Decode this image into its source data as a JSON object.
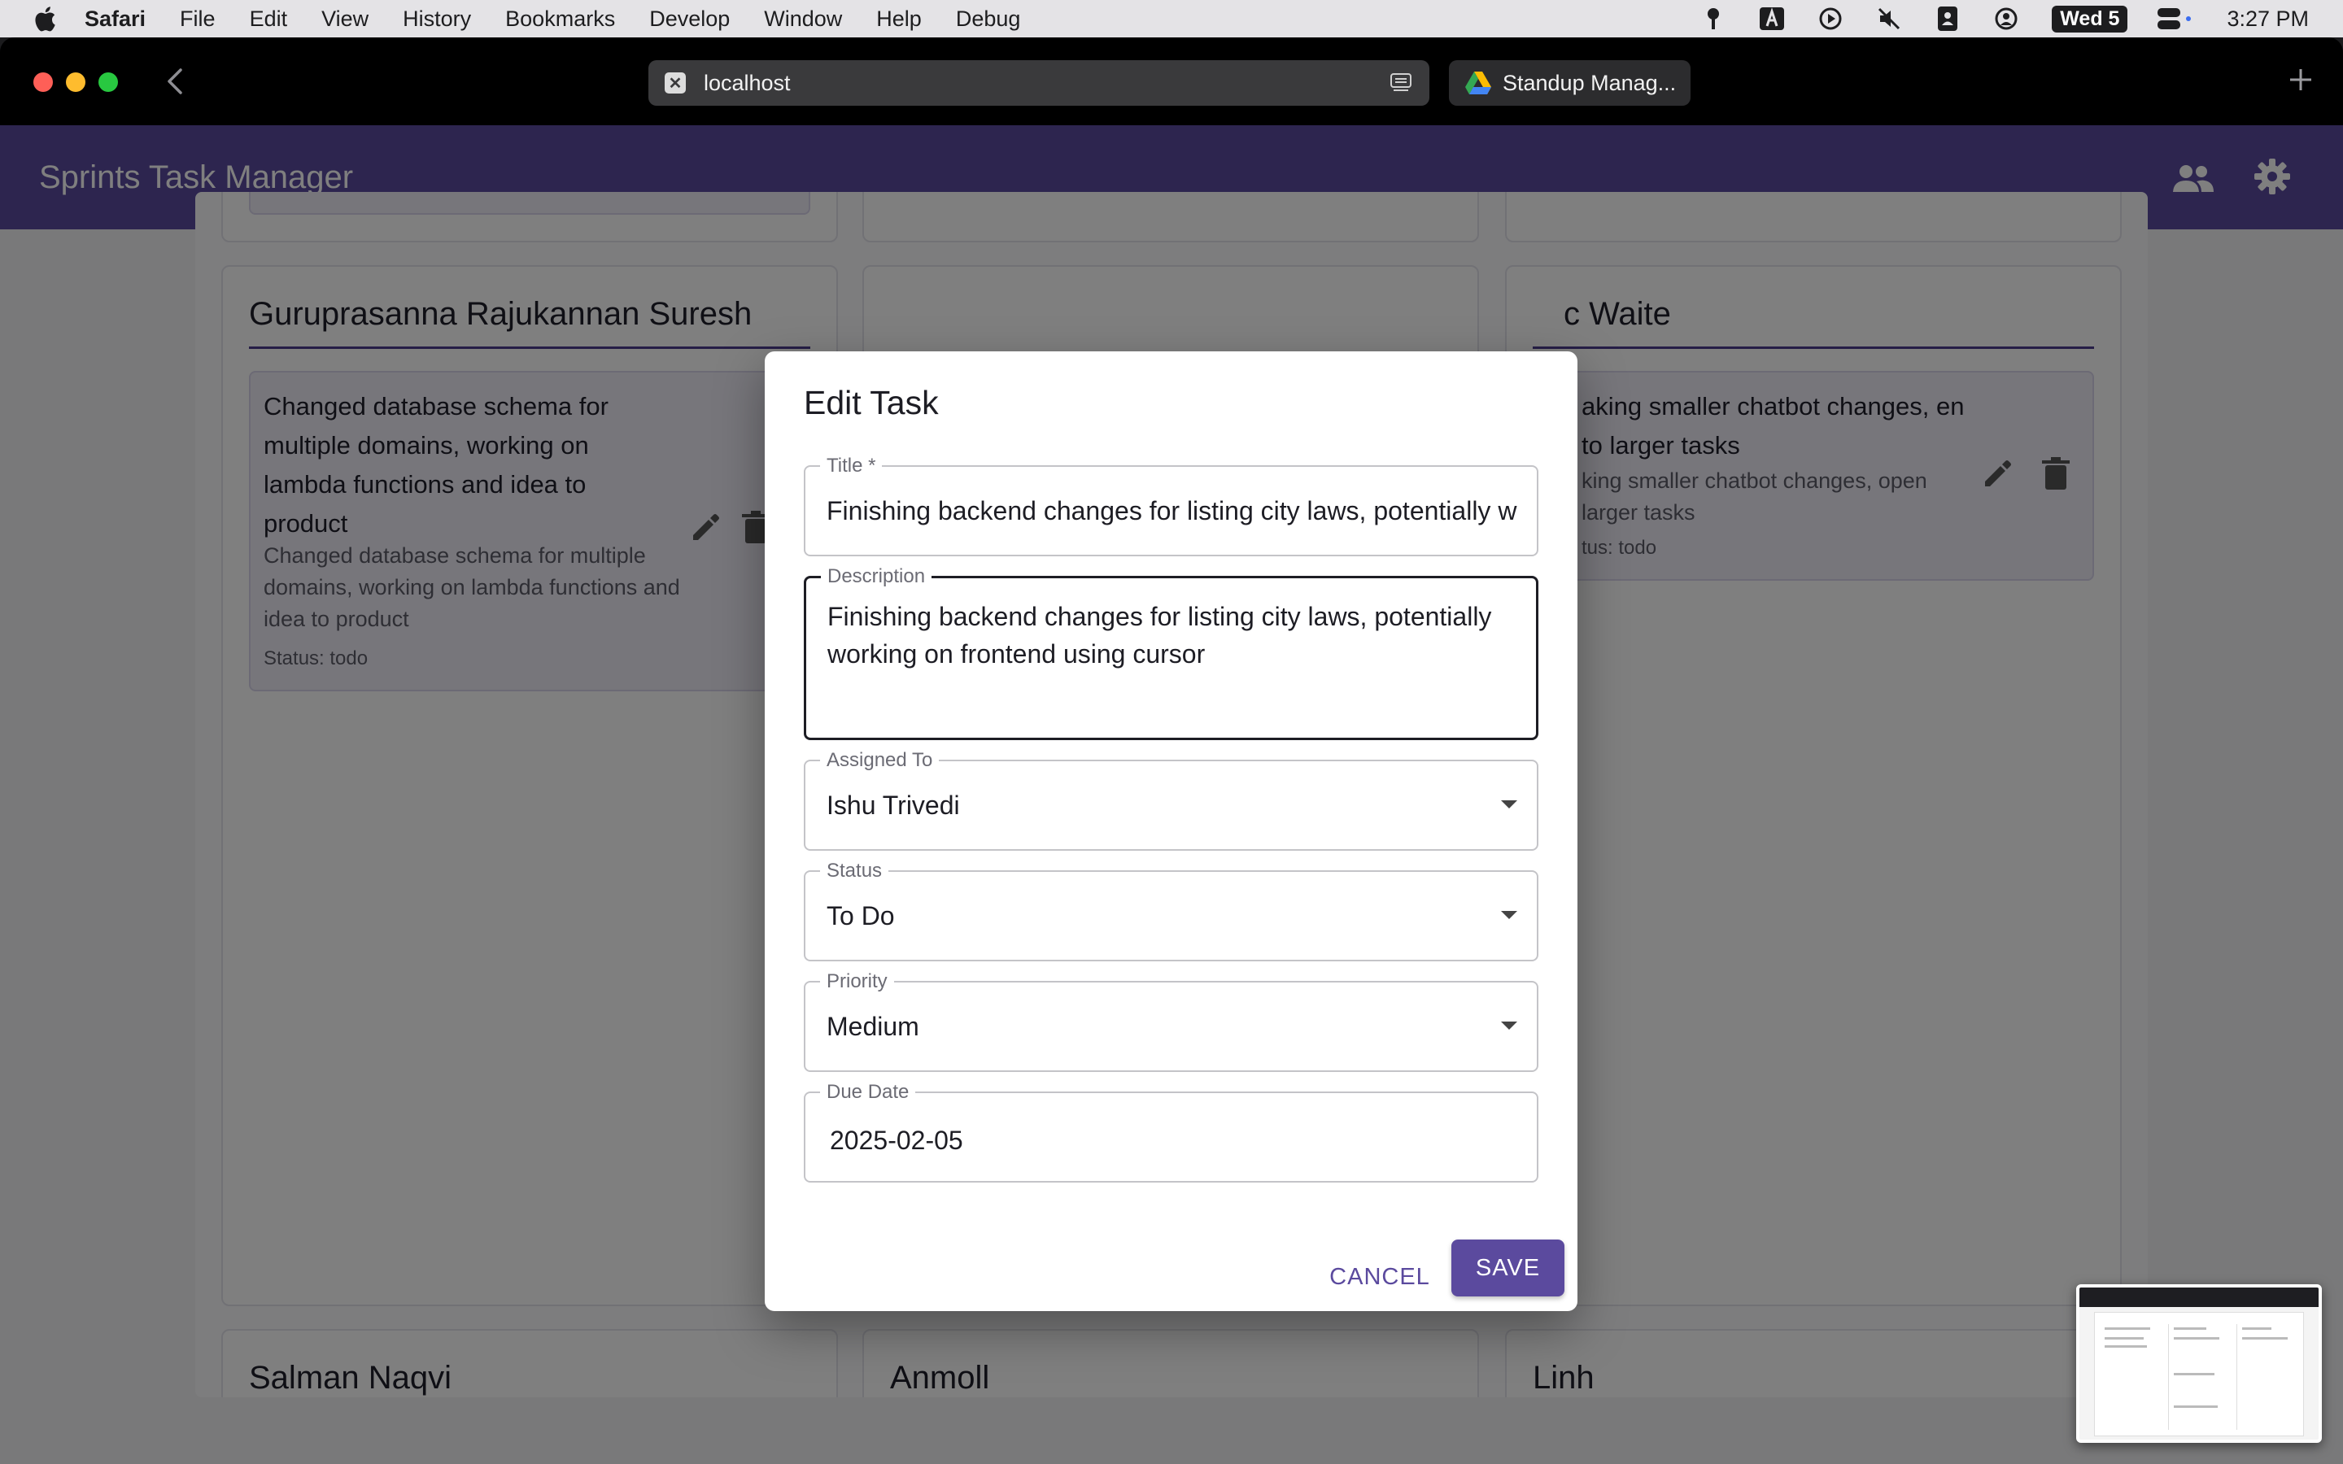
{
  "menubar": {
    "app_name": "Safari",
    "items": [
      "File",
      "Edit",
      "View",
      "History",
      "Bookmarks",
      "Develop",
      "Window",
      "Help",
      "Debug"
    ],
    "date": "Wed 5",
    "time": "3:27 PM"
  },
  "browser": {
    "active_tab": {
      "label": "localhost",
      "favicon": "x-icon"
    },
    "other_tab": {
      "label": "Standup Manag...",
      "favicon": "google-drive-icon"
    }
  },
  "app": {
    "title": "Sprints Task Manager",
    "accent": "#5b4a9e"
  },
  "board": {
    "members": [
      {
        "name": "Guruprasanna Rajukannan Suresh",
        "task": {
          "title": "Changed database schema for multiple domains, working on lambda functions and idea to product",
          "description": "Changed database schema for multiple domains, working on lambda functions and idea to product",
          "status": "Status: todo"
        }
      },
      {
        "name": "c Waite",
        "task": {
          "title": "aking smaller chatbot changes, en to larger tasks",
          "description": "king smaller chatbot changes, open larger tasks",
          "status": "tus: todo"
        }
      }
    ],
    "next_row": [
      "Salman Naqvi",
      "Anmoll",
      "Linh"
    ]
  },
  "dialog": {
    "title": "Edit Task",
    "fields": {
      "title": {
        "label": "Title *",
        "value": "Finishing backend changes for listing city laws, potentially w"
      },
      "description": {
        "label": "Description",
        "value": "Finishing backend changes for listing city laws, potentially working on frontend using cursor"
      },
      "assigned_to": {
        "label": "Assigned To",
        "value": "Ishu Trivedi"
      },
      "status": {
        "label": "Status",
        "value": "To Do"
      },
      "priority": {
        "label": "Priority",
        "value": "Medium"
      },
      "due_date": {
        "label": "Due Date",
        "value": "2025-02-05"
      }
    },
    "cancel_label": "CANCEL",
    "save_label": "SAVE"
  }
}
